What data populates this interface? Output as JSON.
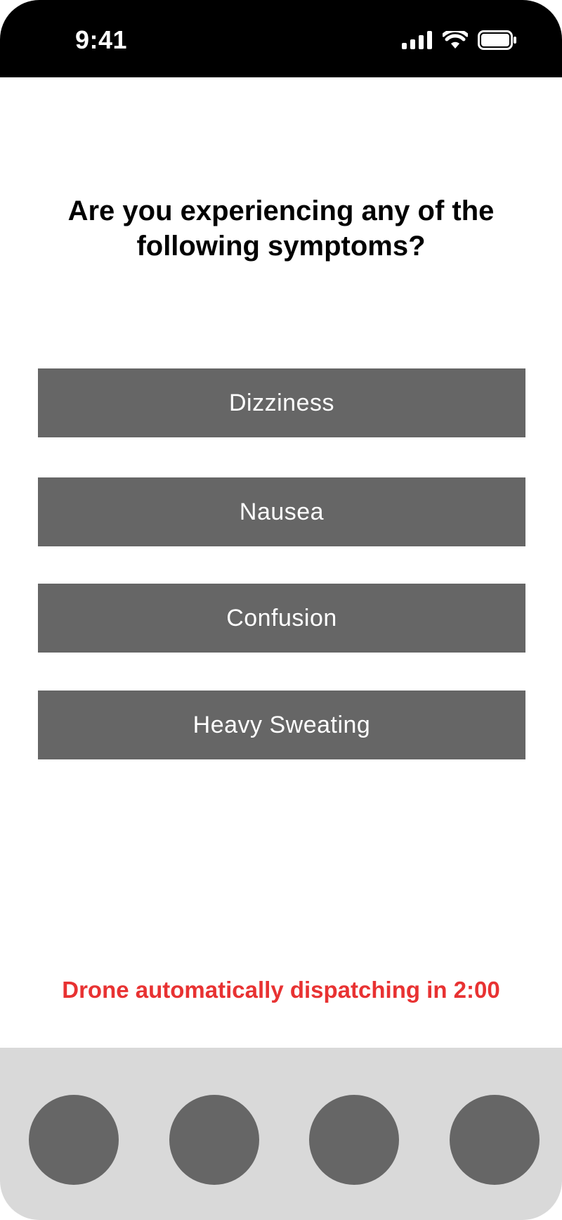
{
  "status_bar": {
    "time": "9:41",
    "icons": [
      "signal-icon",
      "wifi-icon",
      "battery-icon"
    ]
  },
  "question": {
    "title": "Are you experiencing any of the following symptoms?"
  },
  "symptoms": [
    {
      "label": "Dizziness"
    },
    {
      "label": "Nausea"
    },
    {
      "label": "Confusion"
    },
    {
      "label": "Heavy Sweating"
    }
  ],
  "dispatch_notice": {
    "text": "Drone automatically dispatching in 2:00",
    "color": "#e83232"
  },
  "bottom_nav": {
    "items": [
      "nav-item-1",
      "nav-item-2",
      "nav-item-3",
      "nav-item-4"
    ]
  },
  "colors": {
    "button_bg": "#666666",
    "bottom_bar_bg": "#d9d9d9",
    "status_bar_bg": "#000000"
  }
}
